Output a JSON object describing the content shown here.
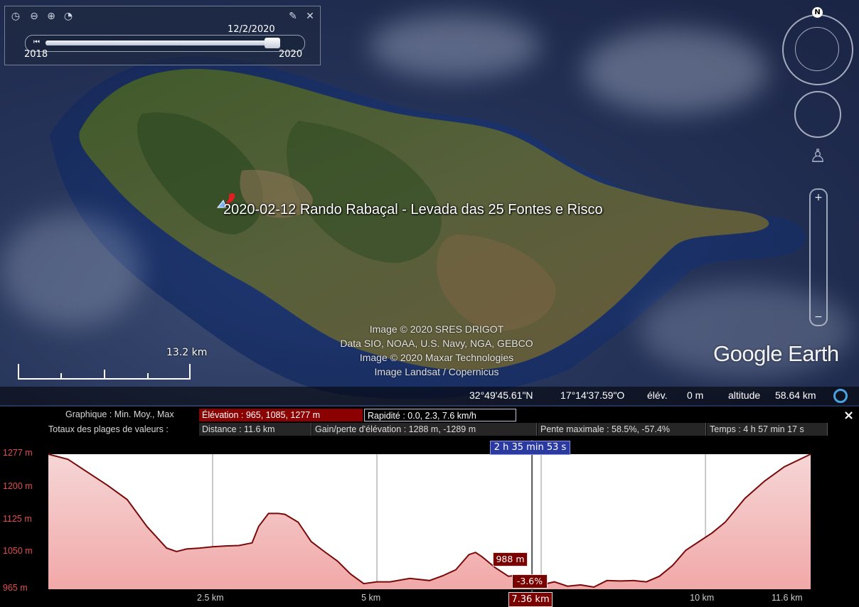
{
  "time_slider": {
    "date": "12/2/2020",
    "start_year": "2018",
    "end_year": "2020",
    "position_fraction": 0.92
  },
  "map": {
    "placemark_label": "2020-02-12 Rando Rabaçal - Levada das 25 Fontes e Risco",
    "attribution": [
      "Image © 2020 SRES DRIGOT",
      "Data SIO, NOAA, U.S. Navy, NGA, GEBCO",
      "Image © 2020 Maxar Technologies",
      "Image Landsat / Copernicus"
    ],
    "logo": "Google Earth",
    "scale": "13.2  km",
    "compass_north": "N"
  },
  "statusbar": {
    "lat": "32°49'45.61\"N",
    "lon": "17°14'37.59\"O",
    "elev_label": "élév.",
    "elev_value": "0 m",
    "alt_label": "altitude",
    "alt_value": "58.64 km"
  },
  "profile": {
    "graph_label": "Graphique : Min. Moy., Max",
    "elevation_box": "Élévation : 965, 1085, 1277 m",
    "speed_box": "Rapidité : 0.0, 2.3, 7.6 km/h",
    "totals_label": "Totaux des plages de valeurs :",
    "stats": {
      "distance": "Distance : 11.6 km",
      "gain": "Gain/perte d'élévation : 1288 m, -1289 m",
      "slope": "Pente maximale : 58.5%, -57.4%",
      "time": "Temps : 4 h 57 min 17 s"
    },
    "cursor": {
      "time": "2 h 35 min 53 s",
      "elevation": "988 m",
      "slope": "-3.6%",
      "distance": "7.36 km",
      "distance_value": 7.36
    },
    "close_symbol": "×"
  },
  "chart_data": {
    "type": "area",
    "xlabel": "",
    "ylabel": "",
    "xlim": [
      0,
      11.6
    ],
    "ylim": [
      965,
      1277
    ],
    "y_ticks": [
      {
        "v": 1277,
        "t": "1277 m"
      },
      {
        "v": 1200,
        "t": "1200 m"
      },
      {
        "v": 1125,
        "t": "1125 m"
      },
      {
        "v": 1050,
        "t": "1050 m"
      },
      {
        "v": 965,
        "t": "965 m"
      }
    ],
    "x_ticks": [
      {
        "v": 2.5,
        "t": "2.5 km"
      },
      {
        "v": 5,
        "t": "5 km"
      },
      {
        "v": 10,
        "t": "10 km"
      },
      {
        "v": 11.6,
        "t": "11.6 km"
      }
    ],
    "x": [
      0,
      0.3,
      0.6,
      0.9,
      1.2,
      1.5,
      1.8,
      1.95,
      2.1,
      2.3,
      2.5,
      2.7,
      2.9,
      3.1,
      3.2,
      3.35,
      3.5,
      3.6,
      3.8,
      4.0,
      4.2,
      4.4,
      4.6,
      4.8,
      5.0,
      5.2,
      5.5,
      5.8,
      6.0,
      6.2,
      6.4,
      6.5,
      6.6,
      6.8,
      7.0,
      7.2,
      7.36,
      7.5,
      7.7,
      7.9,
      8.1,
      8.3,
      8.5,
      8.7,
      8.9,
      9.1,
      9.3,
      9.5,
      9.7,
      9.9,
      10.1,
      10.3,
      10.6,
      10.9,
      11.2,
      11.6
    ],
    "series": [
      {
        "values": [
          1277,
          1265,
          1235,
          1205,
          1172,
          1110,
          1060,
          1052,
          1058,
          1060,
          1063,
          1065,
          1066,
          1072,
          1110,
          1140,
          1140,
          1138,
          1120,
          1075,
          1052,
          1030,
          1000,
          978,
          982,
          982,
          990,
          985,
          996,
          1010,
          1045,
          1050,
          1040,
          1015,
          995,
          998,
          988,
          975,
          982,
          972,
          975,
          970,
          985,
          984,
          985,
          982,
          995,
          1020,
          1055,
          1075,
          1095,
          1120,
          1175,
          1215,
          1248,
          1277
        ]
      }
    ]
  }
}
